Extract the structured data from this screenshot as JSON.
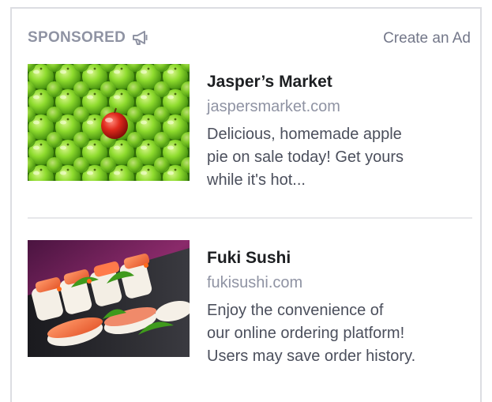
{
  "header": {
    "sponsored_label": "SPONSORED",
    "sponsored_icon": "megaphone-icon",
    "create_ad_label": "Create an Ad"
  },
  "ads": [
    {
      "title": "Jasper’s Market",
      "url": "jaspersmarket.com",
      "description_lines": [
        "Delicious, homemade apple",
        "pie on sale today! Get yours",
        "while it's hot..."
      ]
    },
    {
      "title": "Fuki Sushi",
      "url": "fukisushi.com",
      "description_lines": [
        "Enjoy the convenience of",
        "our online ordering platform!",
        "Users may save order history."
      ]
    }
  ],
  "colors": {
    "border": "#dcdde2",
    "muted_text": "#8f93a3",
    "title_text": "#1c1e21",
    "body_text": "#4b4f5c",
    "apple_green": "#7ad32a",
    "apple_red": "#d81f1f"
  }
}
